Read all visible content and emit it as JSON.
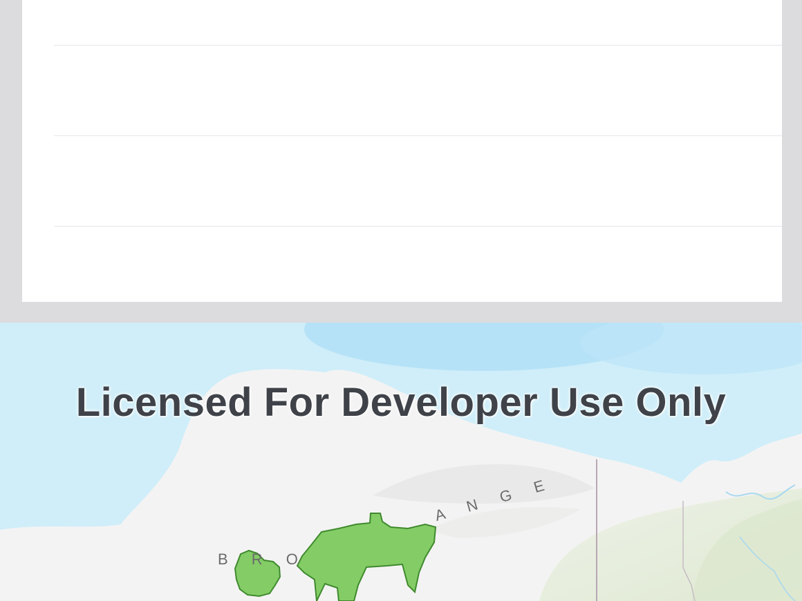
{
  "list": {
    "rows": [
      {
        "label": ""
      },
      {
        "label": ""
      },
      {
        "label": ""
      },
      {
        "label": ""
      }
    ]
  },
  "map": {
    "watermark": "Licensed For Developer Use Only",
    "labels": {
      "range_left": "B R O",
      "range_right": "A N G E"
    },
    "colors": {
      "ocean": "#cfeef9",
      "deep_ocean": "#a9dcf4",
      "land": "#f4f3f3",
      "vegetation": "#e4ecd9",
      "feature_fill": "#84cc66",
      "feature_stroke": "#3f8a2e",
      "border_line": "#b9a7b5"
    }
  }
}
